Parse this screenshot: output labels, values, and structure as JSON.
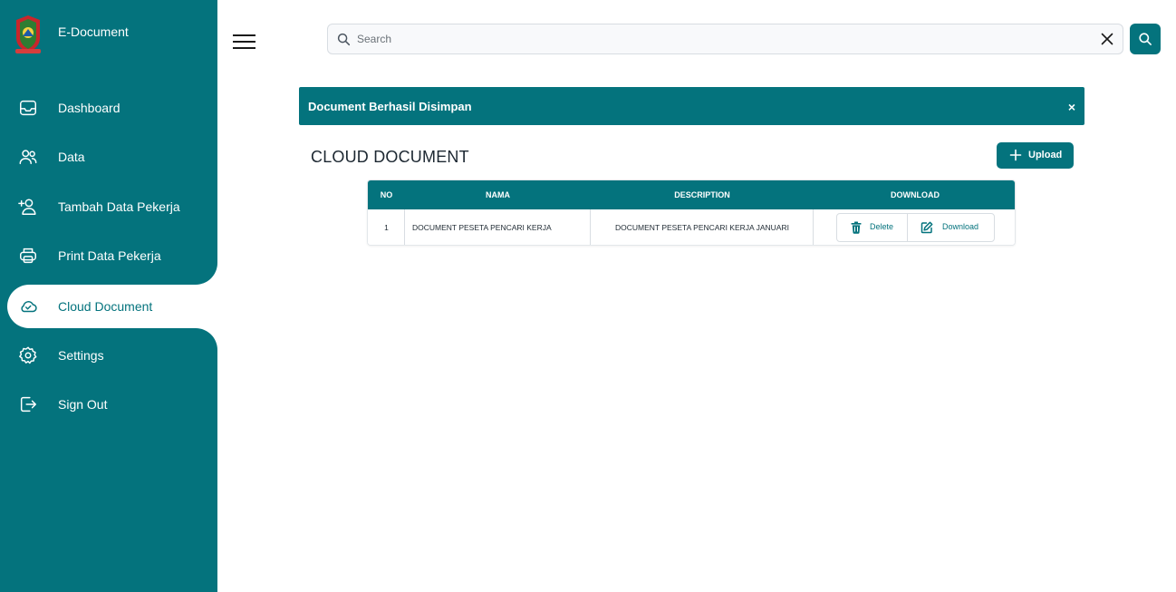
{
  "app": {
    "name": "E-Document"
  },
  "sidebar": {
    "items": [
      {
        "label": "Dashboard",
        "icon": "inbox-tray-icon"
      },
      {
        "label": "Data",
        "icon": "users-icon"
      },
      {
        "label": "Tambah Data Pekerja",
        "icon": "user-plus-icon"
      },
      {
        "label": "Print Data Pekerja",
        "icon": "printer-icon"
      },
      {
        "label": "Cloud Document",
        "icon": "cloud-check-icon",
        "active": true
      },
      {
        "label": "Settings",
        "icon": "gear-icon"
      },
      {
        "label": "Sign Out",
        "icon": "sign-out-icon"
      }
    ]
  },
  "search": {
    "placeholder": "Search",
    "value": ""
  },
  "alert": {
    "message": "Document Berhasil Disimpan",
    "close": "×"
  },
  "page": {
    "title": "CLOUD DOCUMENT",
    "upload_label": "Upload"
  },
  "table": {
    "columns": [
      "NO",
      "NAMA",
      "DESCRIPTION",
      "DOWNLOAD"
    ],
    "rows": [
      {
        "no": "1",
        "nama": "DOCUMENT PESETA PENCARI KERJA",
        "description": "DOCUMENT PESETA PENCARI KERJA JANUARI",
        "actions": {
          "delete": "Delete",
          "download": "Download"
        }
      }
    ]
  },
  "colors": {
    "primary": "#04737d",
    "background": "#ffffff",
    "border": "#d8dde2"
  }
}
